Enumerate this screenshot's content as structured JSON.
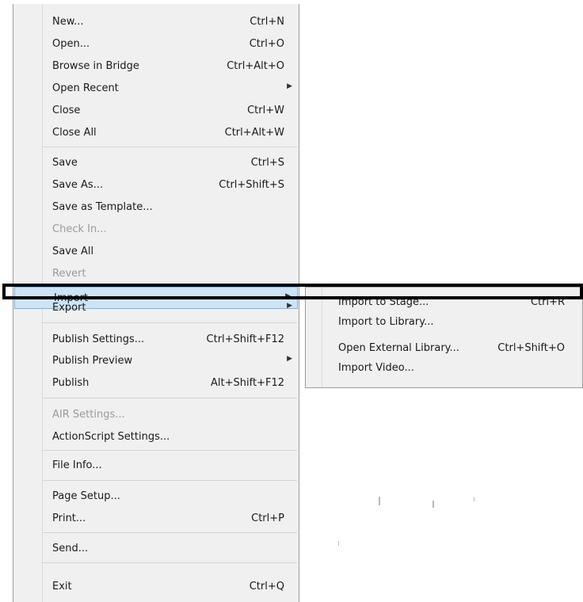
{
  "file_menu": {
    "items": [
      {
        "label": "New...",
        "shortcut": "Ctrl+N"
      },
      {
        "label": "Open...",
        "shortcut": "Ctrl+O"
      },
      {
        "label": "Browse in Bridge",
        "shortcut": "Ctrl+Alt+O"
      },
      {
        "label": "Open Recent",
        "shortcut": ""
      },
      {
        "label": "Close",
        "shortcut": "Ctrl+W"
      },
      {
        "label": "Close All",
        "shortcut": "Ctrl+Alt+W"
      },
      {
        "label": "Save",
        "shortcut": "Ctrl+S"
      },
      {
        "label": "Save As...",
        "shortcut": "Ctrl+Shift+S"
      },
      {
        "label": "Save as Template...",
        "shortcut": ""
      },
      {
        "label": "Check In...",
        "shortcut": ""
      },
      {
        "label": "Save All",
        "shortcut": ""
      },
      {
        "label": "Revert",
        "shortcut": ""
      },
      {
        "label": "Import",
        "shortcut": ""
      },
      {
        "label": "Export",
        "shortcut": ""
      },
      {
        "label": "Publish Settings...",
        "shortcut": "Ctrl+Shift+F12"
      },
      {
        "label": "Publish Preview",
        "shortcut": ""
      },
      {
        "label": "Publish",
        "shortcut": "Alt+Shift+F12"
      },
      {
        "label": "AIR Settings...",
        "shortcut": ""
      },
      {
        "label": "ActionScript Settings...",
        "shortcut": ""
      },
      {
        "label": "File Info...",
        "shortcut": ""
      },
      {
        "label": "Page Setup...",
        "shortcut": ""
      },
      {
        "label": "Print...",
        "shortcut": "Ctrl+P"
      },
      {
        "label": "Send...",
        "shortcut": ""
      },
      {
        "label": "Exit",
        "shortcut": "Ctrl+Q"
      }
    ]
  },
  "import_submenu": {
    "items": [
      {
        "label": "Import to Stage...",
        "shortcut": "Ctrl+R"
      },
      {
        "label": "Import to Library...",
        "shortcut": ""
      },
      {
        "label": "Open External Library...",
        "shortcut": "Ctrl+Shift+O"
      },
      {
        "label": "Import Video...",
        "shortcut": ""
      }
    ]
  },
  "icons": {
    "submenu_arrow": "triangle-right-icon"
  },
  "colors": {
    "highlight": "#cde4f7",
    "highlight_border": "#7eb4ea",
    "disabled_text": "#9a9a9a",
    "frame": "#000000"
  }
}
